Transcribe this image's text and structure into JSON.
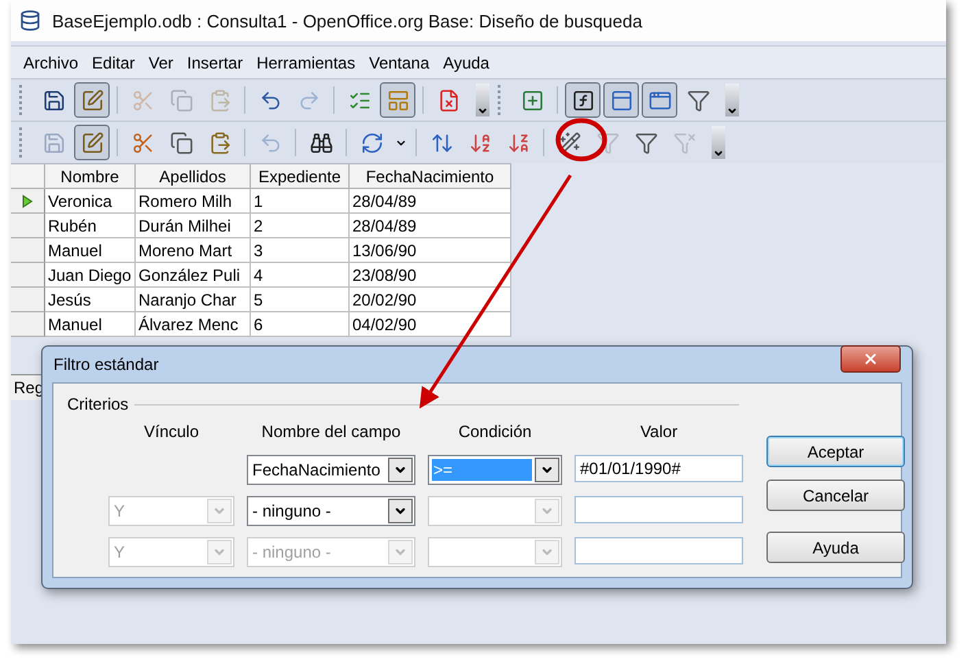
{
  "window": {
    "title": "BaseEjemplo.odb : Consulta1 - OpenOffice.org Base: Diseño de busqueda"
  },
  "menu": [
    "Archivo",
    "Editar",
    "Ver",
    "Insertar",
    "Herramientas",
    "Ventana",
    "Ayuda"
  ],
  "toolbars": [
    {
      "items": [
        {
          "kind": "save",
          "pressed": false,
          "disabled": false
        },
        {
          "kind": "edit",
          "pressed": true,
          "disabled": false
        },
        {
          "kind": "separator"
        },
        {
          "kind": "cut",
          "pressed": false,
          "disabled": true
        },
        {
          "kind": "copy",
          "pressed": false,
          "disabled": true
        },
        {
          "kind": "paste",
          "pressed": false,
          "disabled": true
        },
        {
          "kind": "separator"
        },
        {
          "kind": "undo",
          "pressed": false,
          "disabled": false
        },
        {
          "kind": "redo",
          "pressed": false,
          "disabled": true
        },
        {
          "kind": "separator"
        },
        {
          "kind": "run",
          "pressed": false,
          "disabled": false
        },
        {
          "kind": "design",
          "pressed": true,
          "disabled": false
        },
        {
          "kind": "separator"
        },
        {
          "kind": "clear",
          "pressed": false,
          "disabled": false
        },
        {
          "kind": "overflow"
        },
        {
          "kind": "add-table",
          "pressed": false,
          "disabled": false
        },
        {
          "kind": "separator"
        },
        {
          "kind": "function",
          "pressed": true,
          "disabled": false
        },
        {
          "kind": "table-name",
          "pressed": true,
          "disabled": false
        },
        {
          "kind": "alias",
          "pressed": true,
          "disabled": false
        },
        {
          "kind": "distinct",
          "pressed": false,
          "disabled": false
        },
        {
          "kind": "overflow"
        }
      ]
    },
    {
      "items": [
        {
          "kind": "save",
          "pressed": false,
          "disabled": true
        },
        {
          "kind": "edit",
          "pressed": true,
          "disabled": false
        },
        {
          "kind": "separator"
        },
        {
          "kind": "cut",
          "pressed": false,
          "disabled": false
        },
        {
          "kind": "copy",
          "pressed": false,
          "disabled": false
        },
        {
          "kind": "paste",
          "pressed": false,
          "disabled": false
        },
        {
          "kind": "separator"
        },
        {
          "kind": "undo",
          "pressed": false,
          "disabled": true
        },
        {
          "kind": "separator"
        },
        {
          "kind": "find",
          "pressed": false,
          "disabled": false
        },
        {
          "kind": "separator"
        },
        {
          "kind": "refresh",
          "pressed": false,
          "disabled": false
        },
        {
          "kind": "dropdown"
        },
        {
          "kind": "separator"
        },
        {
          "kind": "sort",
          "pressed": false,
          "disabled": false
        },
        {
          "kind": "sort-asc",
          "pressed": false,
          "disabled": false
        },
        {
          "kind": "sort-desc",
          "pressed": false,
          "disabled": false
        },
        {
          "kind": "separator"
        },
        {
          "kind": "autofilter",
          "pressed": false,
          "disabled": false
        },
        {
          "kind": "apply-filter",
          "pressed": false,
          "disabled": true
        },
        {
          "kind": "standard-filter",
          "pressed": false,
          "disabled": false
        },
        {
          "kind": "remove-filter",
          "pressed": false,
          "disabled": true
        },
        {
          "kind": "overflow"
        }
      ]
    }
  ],
  "table": {
    "columns": [
      "Nombre",
      "Apellidos",
      "Expediente",
      "FechaNacimiento"
    ],
    "rows": [
      {
        "selected": true,
        "cells": [
          "Veronica",
          "Romero Milh",
          "1",
          "28/04/89"
        ]
      },
      {
        "selected": false,
        "cells": [
          "Rubén",
          "Durán Milhei",
          "2",
          "28/04/89"
        ]
      },
      {
        "selected": false,
        "cells": [
          "Manuel",
          "Moreno Mart",
          "3",
          "13/06/90"
        ]
      },
      {
        "selected": false,
        "cells": [
          "Juan Diego",
          "González Puli",
          "4",
          "23/08/90"
        ]
      },
      {
        "selected": false,
        "cells": [
          "Jesús",
          "Naranjo Char",
          "5",
          "20/02/90"
        ]
      },
      {
        "selected": false,
        "cells": [
          "Manuel",
          "Álvarez Menc",
          "6",
          "04/02/90"
        ]
      }
    ]
  },
  "status_bar": {
    "text": "Reg"
  },
  "dialog": {
    "title": "Filtro estándar",
    "group": "Criterios",
    "headers": [
      "Vínculo",
      "Nombre del campo",
      "Condición",
      "Valor"
    ],
    "rows": [
      {
        "field": {
          "value": "FechaNacimiento",
          "disabled": false
        },
        "condition": {
          "value": ">=",
          "disabled": false,
          "selected": true
        },
        "value": "#01/01/1990#"
      },
      {
        "link": {
          "value": "Y",
          "disabled": true
        },
        "field": {
          "value": "- ninguno -",
          "disabled": false
        },
        "condition": {
          "disabled": true
        }
      },
      {
        "link": {
          "value": "Y",
          "disabled": true
        },
        "field": {
          "value": "- ninguno -",
          "disabled": true
        },
        "condition": {
          "disabled": true
        }
      }
    ],
    "buttons": [
      {
        "label": "Aceptar",
        "default": true
      },
      {
        "label": "Cancelar",
        "default": false
      },
      {
        "label": "Ayuda",
        "default": false
      }
    ]
  }
}
